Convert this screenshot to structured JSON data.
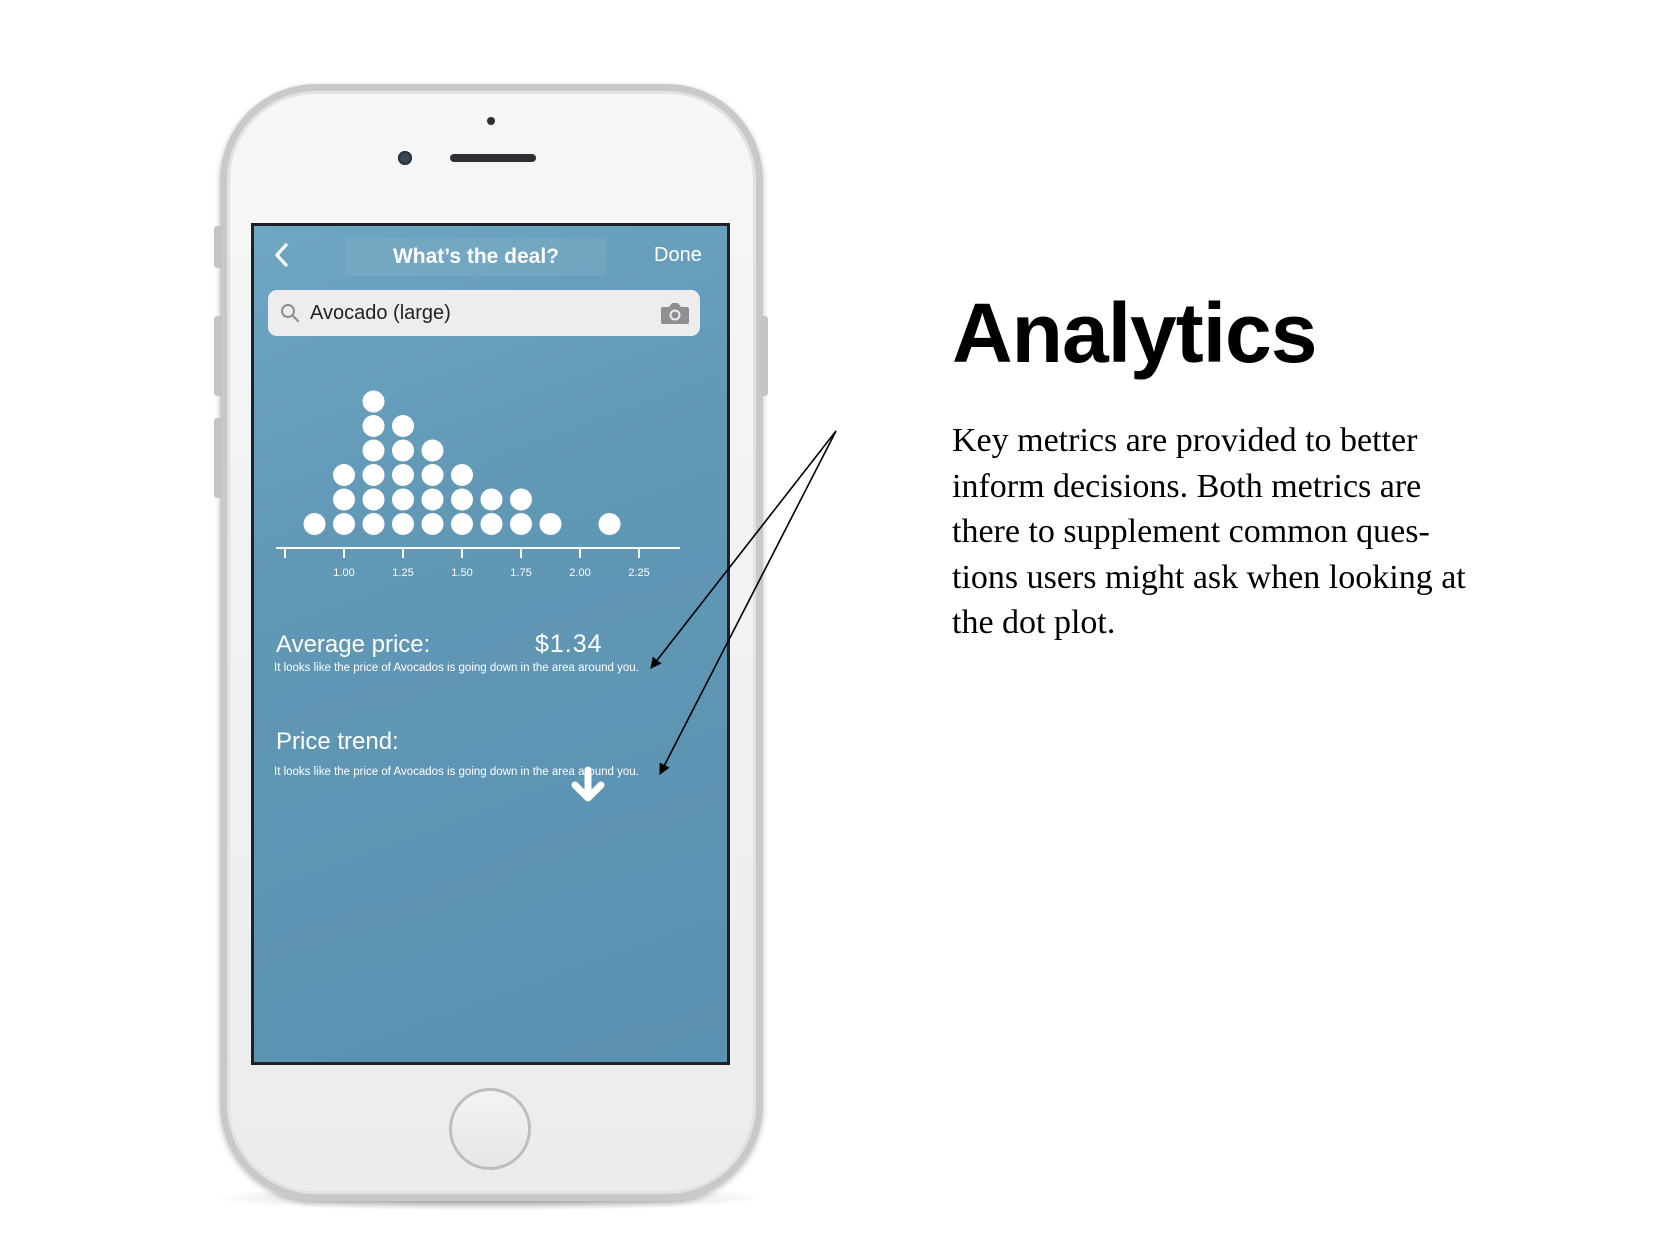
{
  "app": {
    "nav": {
      "back_glyph": "‹",
      "title": "What’s the deal?",
      "done_label": "Done"
    },
    "search": {
      "value": "Avocado (large)",
      "icons": [
        "search-icon",
        "camera-icon"
      ]
    },
    "chart_data": {
      "type": "scatter",
      "title": "",
      "xlabel": "",
      "ylabel": "",
      "x_ticks": [
        "1.00",
        "1.25",
        "1.50",
        "1.75",
        "2.00",
        "2.25"
      ],
      "xlim": [
        0.75,
        2.4
      ],
      "dot_columns": [
        {
          "x": 0.875,
          "count": 1
        },
        {
          "x": 1.0,
          "count": 3
        },
        {
          "x": 1.125,
          "count": 6
        },
        {
          "x": 1.25,
          "count": 5
        },
        {
          "x": 1.375,
          "count": 4
        },
        {
          "x": 1.5,
          "count": 3
        },
        {
          "x": 1.625,
          "count": 2
        },
        {
          "x": 1.75,
          "count": 2
        },
        {
          "x": 1.875,
          "count": 1
        },
        {
          "x": 2.125,
          "count": 1
        }
      ]
    },
    "metrics": {
      "average_label": "Average price:",
      "average_value": "$1.34",
      "average_note": "It looks like the price of Avocados is going down in the area around you.",
      "trend_label": "Price trend:",
      "trend_direction": "down",
      "trend_note": "It looks like the price of Avocados is going down in the area around you."
    },
    "colors": {
      "screen": "#6198b6",
      "dot": "#ffffff"
    }
  },
  "annotation": {
    "heading": "Analytics",
    "lines": [
      "Key metrics are provided to better",
      "inform decisions. Both metrics are",
      "there to supplement common ques-",
      "tions users might ask when looking at",
      "the dot plot."
    ]
  }
}
